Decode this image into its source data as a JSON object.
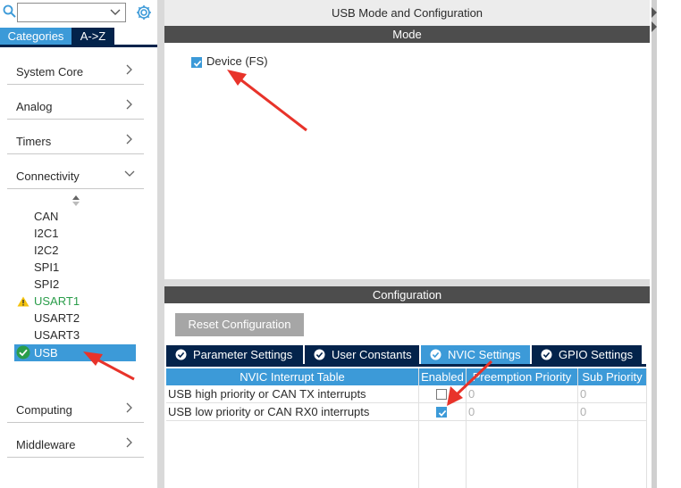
{
  "sidebar": {
    "search": {
      "value": ""
    },
    "tabs": [
      {
        "label": "Categories",
        "active": true
      },
      {
        "label": "A->Z",
        "active": false
      }
    ],
    "categories": [
      {
        "label": "System Core",
        "expanded": false
      },
      {
        "label": "Analog",
        "expanded": false
      },
      {
        "label": "Timers",
        "expanded": false
      },
      {
        "label": "Connectivity",
        "expanded": true
      },
      {
        "label": "Computing",
        "expanded": false
      },
      {
        "label": "Middleware",
        "expanded": false
      }
    ],
    "peripherals": [
      {
        "label": "CAN",
        "status": "none"
      },
      {
        "label": "I2C1",
        "status": "none"
      },
      {
        "label": "I2C2",
        "status": "none"
      },
      {
        "label": "SPI1",
        "status": "none"
      },
      {
        "label": "SPI2",
        "status": "none"
      },
      {
        "label": "USART1",
        "status": "warning"
      },
      {
        "label": "USART2",
        "status": "none"
      },
      {
        "label": "USART3",
        "status": "none"
      },
      {
        "label": "USB",
        "status": "ok",
        "selected": true
      }
    ]
  },
  "main": {
    "title": "USB Mode and Configuration",
    "mode": {
      "header": "Mode",
      "device_label": "Device (FS)",
      "device_checked": true
    },
    "configuration": {
      "header": "Configuration",
      "reset_label": "Reset Configuration",
      "tabs": [
        {
          "label": "Parameter Settings",
          "active": false
        },
        {
          "label": "User Constants",
          "active": false
        },
        {
          "label": "NVIC Settings",
          "active": true
        },
        {
          "label": "GPIO Settings",
          "active": false
        }
      ],
      "table": {
        "headers": [
          "NVIC Interrupt Table",
          "Enabled",
          "Preemption Priority",
          "Sub Priority"
        ],
        "rows": [
          {
            "name": "USB high priority or CAN TX interrupts",
            "enabled": false,
            "preemption": "0",
            "sub": "0"
          },
          {
            "name": "USB low priority or CAN RX0 interrupts",
            "enabled": true,
            "preemption": "0",
            "sub": "0"
          }
        ]
      }
    }
  },
  "colors": {
    "accent": "#3c9ad8",
    "navy": "#03234b",
    "header_gray": "#4d4d4d",
    "warning": "#f4c20d",
    "ok_green": "#2a9d4a",
    "annotation_red": "#e8332a"
  }
}
